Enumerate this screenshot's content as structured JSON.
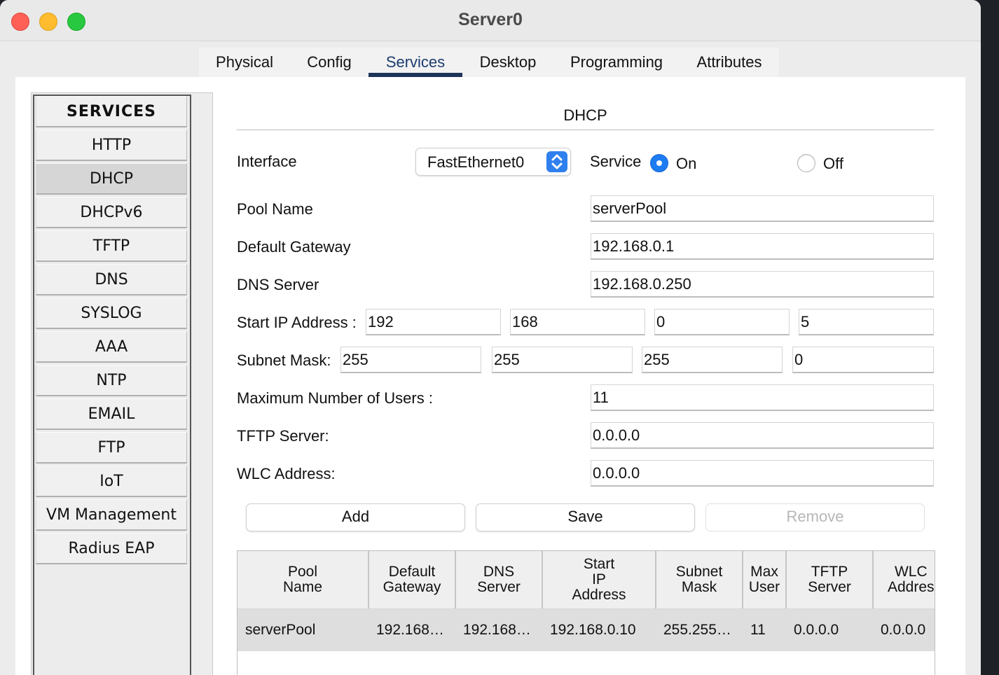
{
  "window": {
    "title": "Server0"
  },
  "tabs": [
    "Physical",
    "Config",
    "Services",
    "Desktop",
    "Programming",
    "Attributes"
  ],
  "active_tab": "Services",
  "sidebar": {
    "header": "SERVICES",
    "items": [
      "HTTP",
      "DHCP",
      "DHCPv6",
      "TFTP",
      "DNS",
      "SYSLOG",
      "AAA",
      "NTP",
      "EMAIL",
      "FTP",
      "IoT",
      "VM Management",
      "Radius EAP"
    ],
    "selected": "DHCP"
  },
  "dhcp": {
    "title": "DHCP",
    "interface_label": "Interface",
    "interface_value": "FastEthernet0",
    "service_label": "Service",
    "on_label": "On",
    "off_label": "Off",
    "service_state": "On",
    "pool_name_label": "Pool Name",
    "pool_name": "serverPool",
    "gateway_label": "Default Gateway",
    "gateway": "192.168.0.1",
    "dns_label": "DNS Server",
    "dns": "192.168.0.250",
    "start_ip_label": "Start IP Address :",
    "start_ip": [
      "192",
      "168",
      "0",
      "5"
    ],
    "subnet_label": "Subnet Mask:",
    "subnet": [
      "255",
      "255",
      "255",
      "0"
    ],
    "max_users_label": "Maximum Number of Users :",
    "max_users": "11",
    "tftp_label": "TFTP Server:",
    "tftp": "0.0.0.0",
    "wlc_label": "WLC Address:",
    "wlc": "0.0.0.0",
    "add_button": "Add",
    "save_button": "Save",
    "remove_button": "Remove"
  },
  "table": {
    "columns": [
      "Pool\nName",
      "Default\nGateway",
      "DNS\nServer",
      "Start\nIP\nAddress",
      "Subnet\nMask",
      "Max\nUser",
      "TFTP\nServer",
      "WLC\nAddres"
    ],
    "rows": [
      [
        "serverPool",
        "192.168…",
        "192.168…",
        "192.168.0.10",
        "255.255…",
        "11",
        "0.0.0.0",
        "0.0.0.0"
      ]
    ]
  },
  "colors": {
    "accent_blue": "#1d7cf2",
    "tab_underline": "#1e3559"
  }
}
